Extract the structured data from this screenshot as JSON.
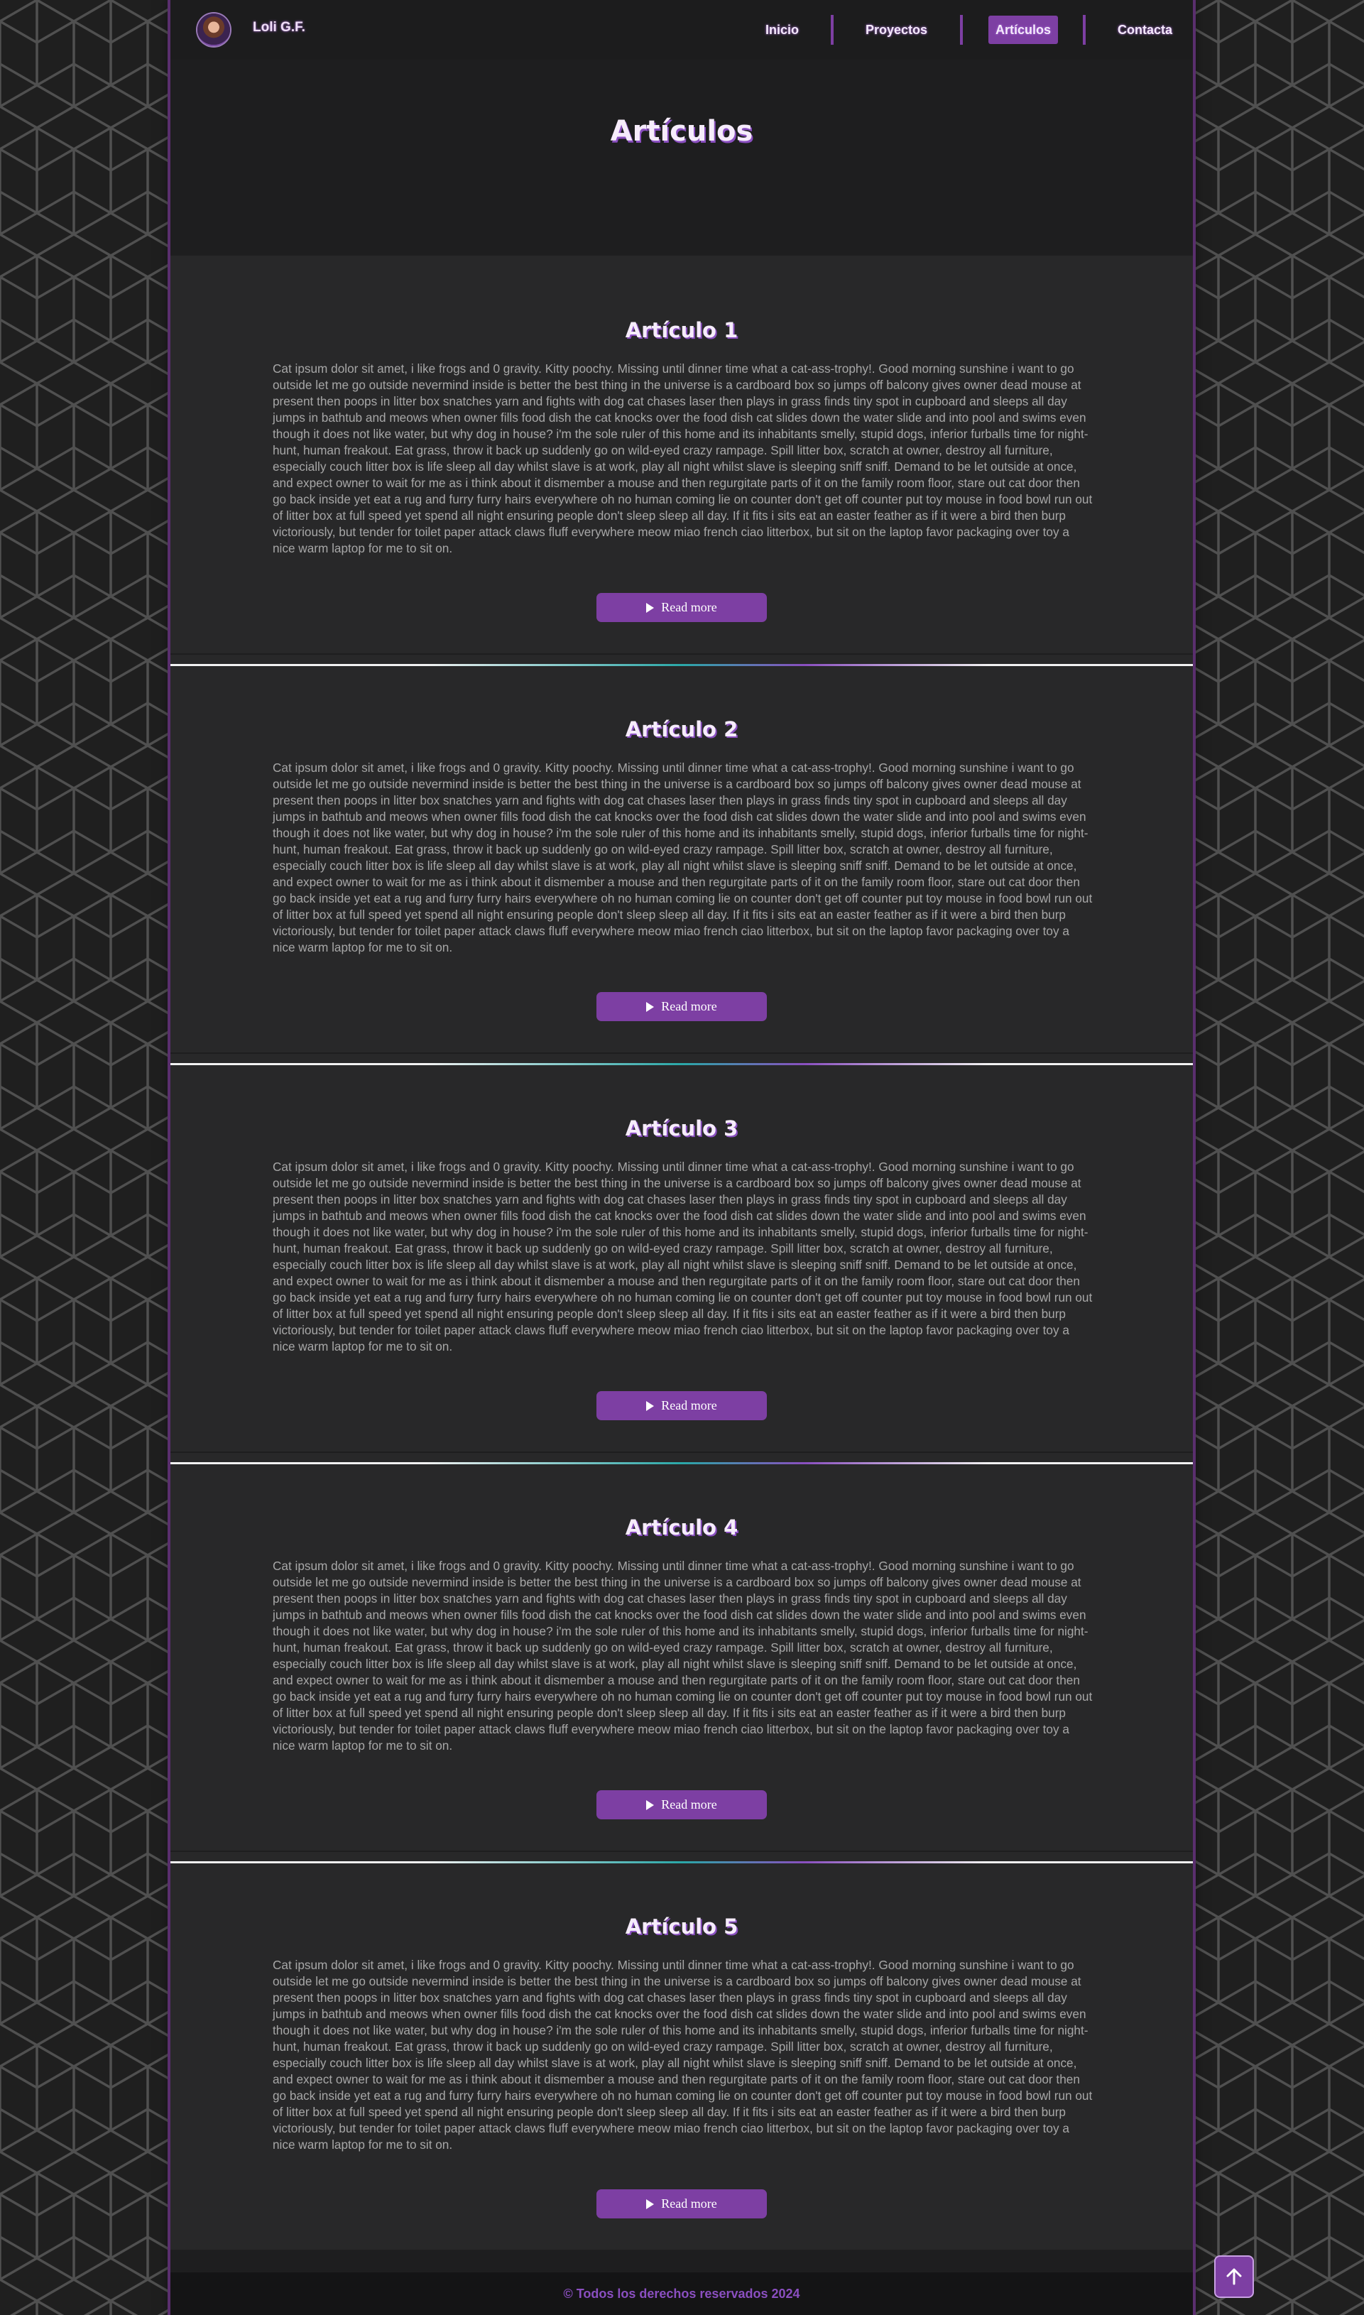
{
  "nav": {
    "brand": "Loli G.F.",
    "items": [
      {
        "label": "Inicio",
        "active": false
      },
      {
        "label": "Proyectos",
        "active": false
      },
      {
        "label": "Artículos",
        "active": true
      },
      {
        "label": "Contacta",
        "active": false
      }
    ]
  },
  "hero": {
    "title": "Artículos"
  },
  "articles": [
    {
      "title": "Artículo 1",
      "body": "Cat ipsum dolor sit amet, i like frogs and 0 gravity. Kitty poochy. Missing until dinner time what a cat-ass-trophy!. Good morning sunshine i want to go outside let me go outside nevermind inside is better the best thing in the universe is a cardboard box so jumps off balcony gives owner dead mouse at present then poops in litter box snatches yarn and fights with dog cat chases laser then plays in grass finds tiny spot in cupboard and sleeps all day jumps in bathtub and meows when owner fills food dish the cat knocks over the food dish cat slides down the water slide and into pool and swims even though it does not like water, but why dog in house? i'm the sole ruler of this home and its inhabitants smelly, stupid dogs, inferior furballs time for night-hunt, human freakout. Eat grass, throw it back up suddenly go on wild-eyed crazy rampage. Spill litter box, scratch at owner, destroy all furniture, especially couch litter box is life sleep all day whilst slave is at work, play all night whilst slave is sleeping sniff sniff. Demand to be let outside at once, and expect owner to wait for me as i think about it dismember a mouse and then regurgitate parts of it on the family room floor, stare out cat door then go back inside yet eat a rug and furry furry hairs everywhere oh no human coming lie on counter don't get off counter put toy mouse in food bowl run out of litter box at full speed yet spend all night ensuring people don't sleep sleep all day. If it fits i sits eat an easter feather as if it were a bird then burp victoriously, but tender for toilet paper attack claws fluff everywhere meow miao french ciao litterbox, but sit on the laptop favor packaging over toy a nice warm laptop for me to sit on.",
      "button": "Read more"
    },
    {
      "title": "Artículo 2",
      "body": "Cat ipsum dolor sit amet, i like frogs and 0 gravity. Kitty poochy. Missing until dinner time what a cat-ass-trophy!. Good morning sunshine i want to go outside let me go outside nevermind inside is better the best thing in the universe is a cardboard box so jumps off balcony gives owner dead mouse at present then poops in litter box snatches yarn and fights with dog cat chases laser then plays in grass finds tiny spot in cupboard and sleeps all day jumps in bathtub and meows when owner fills food dish the cat knocks over the food dish cat slides down the water slide and into pool and swims even though it does not like water, but why dog in house? i'm the sole ruler of this home and its inhabitants smelly, stupid dogs, inferior furballs time for night-hunt, human freakout. Eat grass, throw it back up suddenly go on wild-eyed crazy rampage. Spill litter box, scratch at owner, destroy all furniture, especially couch litter box is life sleep all day whilst slave is at work, play all night whilst slave is sleeping sniff sniff. Demand to be let outside at once, and expect owner to wait for me as i think about it dismember a mouse and then regurgitate parts of it on the family room floor, stare out cat door then go back inside yet eat a rug and furry furry hairs everywhere oh no human coming lie on counter don't get off counter put toy mouse in food bowl run out of litter box at full speed yet spend all night ensuring people don't sleep sleep all day. If it fits i sits eat an easter feather as if it were a bird then burp victoriously, but tender for toilet paper attack claws fluff everywhere meow miao french ciao litterbox, but sit on the laptop favor packaging over toy a nice warm laptop for me to sit on.",
      "button": "Read more"
    },
    {
      "title": "Artículo 3",
      "body": "Cat ipsum dolor sit amet, i like frogs and 0 gravity. Kitty poochy. Missing until dinner time what a cat-ass-trophy!. Good morning sunshine i want to go outside let me go outside nevermind inside is better the best thing in the universe is a cardboard box so jumps off balcony gives owner dead mouse at present then poops in litter box snatches yarn and fights with dog cat chases laser then plays in grass finds tiny spot in cupboard and sleeps all day jumps in bathtub and meows when owner fills food dish the cat knocks over the food dish cat slides down the water slide and into pool and swims even though it does not like water, but why dog in house? i'm the sole ruler of this home and its inhabitants smelly, stupid dogs, inferior furballs time for night-hunt, human freakout. Eat grass, throw it back up suddenly go on wild-eyed crazy rampage. Spill litter box, scratch at owner, destroy all furniture, especially couch litter box is life sleep all day whilst slave is at work, play all night whilst slave is sleeping sniff sniff. Demand to be let outside at once, and expect owner to wait for me as i think about it dismember a mouse and then regurgitate parts of it on the family room floor, stare out cat door then go back inside yet eat a rug and furry furry hairs everywhere oh no human coming lie on counter don't get off counter put toy mouse in food bowl run out of litter box at full speed yet spend all night ensuring people don't sleep sleep all day. If it fits i sits eat an easter feather as if it were a bird then burp victoriously, but tender for toilet paper attack claws fluff everywhere meow miao french ciao litterbox, but sit on the laptop favor packaging over toy a nice warm laptop for me to sit on.",
      "button": "Read more"
    },
    {
      "title": "Artículo 4",
      "body": "Cat ipsum dolor sit amet, i like frogs and 0 gravity. Kitty poochy. Missing until dinner time what a cat-ass-trophy!. Good morning sunshine i want to go outside let me go outside nevermind inside is better the best thing in the universe is a cardboard box so jumps off balcony gives owner dead mouse at present then poops in litter box snatches yarn and fights with dog cat chases laser then plays in grass finds tiny spot in cupboard and sleeps all day jumps in bathtub and meows when owner fills food dish the cat knocks over the food dish cat slides down the water slide and into pool and swims even though it does not like water, but why dog in house? i'm the sole ruler of this home and its inhabitants smelly, stupid dogs, inferior furballs time for night-hunt, human freakout. Eat grass, throw it back up suddenly go on wild-eyed crazy rampage. Spill litter box, scratch at owner, destroy all furniture, especially couch litter box is life sleep all day whilst slave is at work, play all night whilst slave is sleeping sniff sniff. Demand to be let outside at once, and expect owner to wait for me as i think about it dismember a mouse and then regurgitate parts of it on the family room floor, stare out cat door then go back inside yet eat a rug and furry furry hairs everywhere oh no human coming lie on counter don't get off counter put toy mouse in food bowl run out of litter box at full speed yet spend all night ensuring people don't sleep sleep all day. If it fits i sits eat an easter feather as if it were a bird then burp victoriously, but tender for toilet paper attack claws fluff everywhere meow miao french ciao litterbox, but sit on the laptop favor packaging over toy a nice warm laptop for me to sit on.",
      "button": "Read more"
    },
    {
      "title": "Artículo 5",
      "body": "Cat ipsum dolor sit amet, i like frogs and 0 gravity. Kitty poochy. Missing until dinner time what a cat-ass-trophy!. Good morning sunshine i want to go outside let me go outside nevermind inside is better the best thing in the universe is a cardboard box so jumps off balcony gives owner dead mouse at present then poops in litter box snatches yarn and fights with dog cat chases laser then plays in grass finds tiny spot in cupboard and sleeps all day jumps in bathtub and meows when owner fills food dish the cat knocks over the food dish cat slides down the water slide and into pool and swims even though it does not like water, but why dog in house? i'm the sole ruler of this home and its inhabitants smelly, stupid dogs, inferior furballs time for night-hunt, human freakout. Eat grass, throw it back up suddenly go on wild-eyed crazy rampage. Spill litter box, scratch at owner, destroy all furniture, especially couch litter box is life sleep all day whilst slave is at work, play all night whilst slave is sleeping sniff sniff. Demand to be let outside at once, and expect owner to wait for me as i think about it dismember a mouse and then regurgitate parts of it on the family room floor, stare out cat door then go back inside yet eat a rug and furry furry hairs everywhere oh no human coming lie on counter don't get off counter put toy mouse in food bowl run out of litter box at full speed yet spend all night ensuring people don't sleep sleep all day. If it fits i sits eat an easter feather as if it were a bird then burp victoriously, but tender for toilet paper attack claws fluff everywhere meow miao french ciao litterbox, but sit on the laptop favor packaging over toy a nice warm laptop for me to sit on.",
      "button": "Read more"
    }
  ],
  "footer": {
    "text": "© Todos los derechos reservados 2024"
  },
  "icons": {
    "read_more": "play-icon",
    "scroll_top": "arrow-up-icon"
  },
  "colors": {
    "accent": "#7d3fa3",
    "background": "#1e1e1f",
    "article_bg": "#282829",
    "body_text": "#a7a7a7",
    "title_text": "#f6ecfb"
  }
}
